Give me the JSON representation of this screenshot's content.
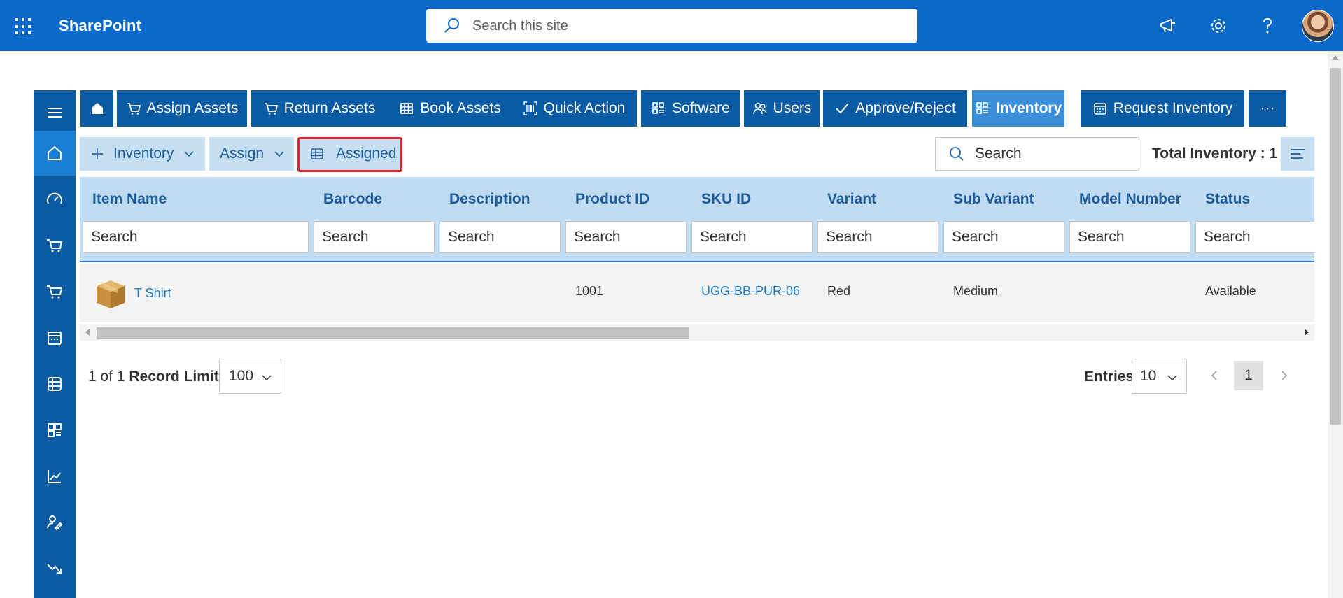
{
  "suite": {
    "brand": "SharePoint",
    "search_placeholder": "Search this site"
  },
  "nav": {
    "home_icon": "home-icon",
    "buttons": [
      {
        "label": "Assign Assets",
        "icon": "cart-icon"
      },
      {
        "label": "Return Assets",
        "icon": "cart-return-icon"
      },
      {
        "label": "Book Assets",
        "icon": "table-icon"
      },
      {
        "label": "Quick Action",
        "icon": "barcode-scan-icon"
      },
      {
        "label": "Software",
        "icon": "grid-list-icon"
      },
      {
        "label": "Users",
        "icon": "people-icon"
      },
      {
        "label": "Approve/Reject",
        "icon": "check-icon"
      },
      {
        "label": "Inventory",
        "icon": "grid-list-icon"
      },
      {
        "label": "Request Inventory",
        "icon": "calendar-icon"
      },
      {
        "label": "···",
        "icon": "more-icon"
      }
    ],
    "active": "Inventory"
  },
  "toolbar": {
    "inventory_label": "Inventory",
    "assign_label": "Assign",
    "assigned_label": "Assigned",
    "search_placeholder": "Search",
    "total_label": "Total Inventory : 1"
  },
  "table": {
    "columns": [
      "Item Name",
      "Barcode",
      "Description",
      "Product ID",
      "SKU ID",
      "Variant",
      "Sub Variant",
      "Model Number",
      "Status"
    ],
    "filter_placeholder": "Search",
    "rows": [
      {
        "item_name": "T Shirt",
        "barcode": "",
        "description": "",
        "product_id": "1001",
        "sku_id": "UGG-BB-PUR-06",
        "variant": "Red",
        "sub_variant": "Medium",
        "model_number": "",
        "status": "Available"
      }
    ]
  },
  "footer": {
    "record_count": "1 of 1",
    "record_limit_label": "Record Limit",
    "record_limit_value": "100",
    "entries_label": "Entries",
    "entries_value": "10",
    "current_page": "1"
  },
  "colors": {
    "suite_bar": "#0b6ac9",
    "nav_button": "#0a5ba3",
    "nav_active": "#3b8fd9",
    "toolbar_button": "#c7dff3",
    "header_bg": "#c0dcf3",
    "highlight_border": "#e0242b",
    "link": "#1e7cc8"
  }
}
